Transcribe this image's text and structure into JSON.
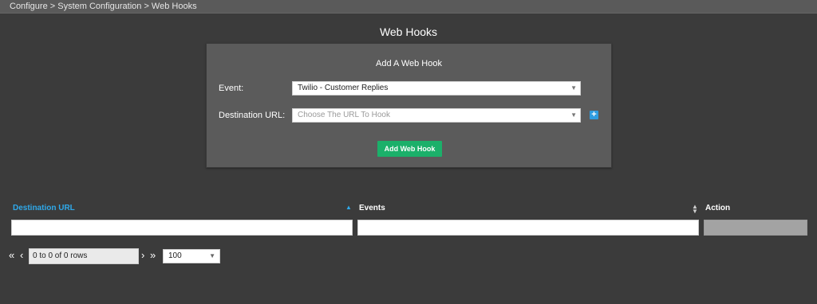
{
  "breadcrumb": "Configure > System Configuration > Web Hooks",
  "page_title": "Web Hooks",
  "form": {
    "title": "Add A Web Hook",
    "event_label": "Event:",
    "event_value": "Twilio - Customer Replies",
    "destination_label": "Destination URL:",
    "destination_placeholder": "Choose The URL To Hook",
    "add_button": "Add Web Hook"
  },
  "table": {
    "columns": [
      "Destination URL",
      "Events",
      "Action"
    ],
    "sorted_column": "Destination URL"
  },
  "pager": {
    "rows_text": "0 to 0 of 0 rows",
    "page_size": "100"
  },
  "colors": {
    "accent_blue": "#2fa9ea",
    "button_green": "#1bb06a",
    "background": "#3b3b3b"
  }
}
